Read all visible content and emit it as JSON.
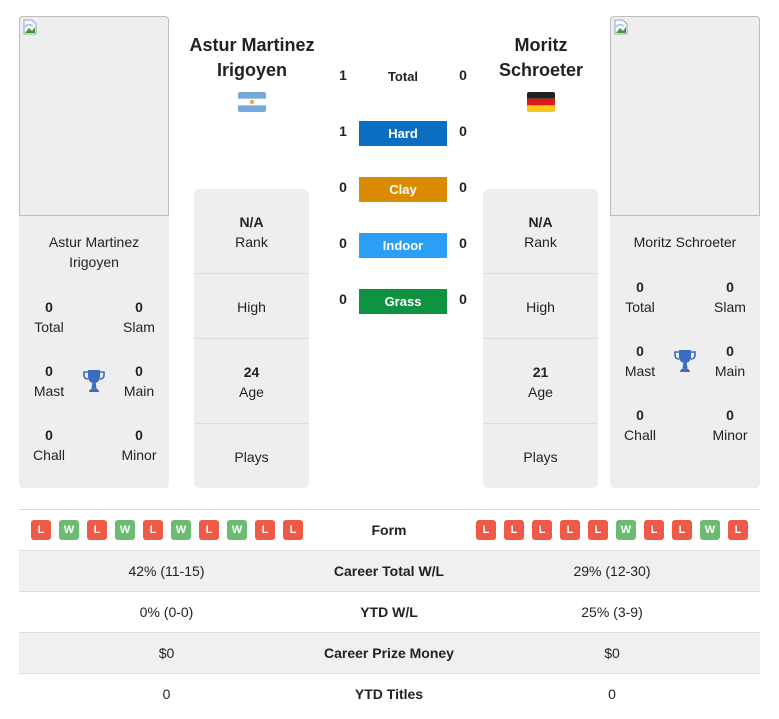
{
  "colors": {
    "hard": "#0a6ec2",
    "clay": "#db8b00",
    "indoor": "#2b9ef5",
    "grass": "#109243",
    "loss": "#ee5a45",
    "win": "#6dbb73",
    "trophy": "#3a6cbf"
  },
  "player1": {
    "name_line1": "Astur Martinez",
    "name_line2": "Irigoyen",
    "card_name_line1": "Astur Martinez",
    "card_name_line2": "Irigoyen",
    "flag": "argentina-flag",
    "titles": {
      "total": {
        "value": "0",
        "label": "Total"
      },
      "slam": {
        "value": "0",
        "label": "Slam"
      },
      "mast": {
        "value": "0",
        "label": "Mast"
      },
      "main": {
        "value": "0",
        "label": "Main"
      },
      "chall": {
        "value": "0",
        "label": "Chall"
      },
      "minor": {
        "value": "0",
        "label": "Minor"
      }
    },
    "info": {
      "rank_value": "N/A",
      "rank_label": "Rank",
      "high_label": "High",
      "age_value": "24",
      "age_label": "Age",
      "plays_label": "Plays"
    },
    "form": [
      "L",
      "W",
      "L",
      "W",
      "L",
      "W",
      "L",
      "W",
      "L",
      "L"
    ],
    "career_wl": "42% (11-15)",
    "ytd_wl": "0% (0-0)",
    "prize_money": "$0",
    "ytd_titles": "0"
  },
  "player2": {
    "name_line1": "Moritz",
    "name_line2": "Schroeter",
    "card_name_line1": "Moritz Schroeter",
    "flag": "germany-flag",
    "titles": {
      "total": {
        "value": "0",
        "label": "Total"
      },
      "slam": {
        "value": "0",
        "label": "Slam"
      },
      "mast": {
        "value": "0",
        "label": "Mast"
      },
      "main": {
        "value": "0",
        "label": "Main"
      },
      "chall": {
        "value": "0",
        "label": "Chall"
      },
      "minor": {
        "value": "0",
        "label": "Minor"
      }
    },
    "info": {
      "rank_value": "N/A",
      "rank_label": "Rank",
      "high_label": "High",
      "age_value": "21",
      "age_label": "Age",
      "plays_label": "Plays"
    },
    "form": [
      "L",
      "L",
      "L",
      "L",
      "L",
      "W",
      "L",
      "L",
      "W",
      "L"
    ],
    "career_wl": "29% (12-30)",
    "ytd_wl": "25% (3-9)",
    "prize_money": "$0",
    "ytd_titles": "0"
  },
  "h2h": [
    {
      "label": "Total",
      "p1": "1",
      "p2": "0"
    },
    {
      "label": "Hard",
      "p1": "1",
      "p2": "0"
    },
    {
      "label": "Clay",
      "p1": "0",
      "p2": "0"
    },
    {
      "label": "Indoor",
      "p1": "0",
      "p2": "0"
    },
    {
      "label": "Grass",
      "p1": "0",
      "p2": "0"
    }
  ],
  "table": {
    "form_label": "Form",
    "career_wl_label": "Career Total W/L",
    "ytd_wl_label": "YTD W/L",
    "prize_label": "Career Prize Money",
    "ytd_titles_label": "YTD Titles"
  }
}
